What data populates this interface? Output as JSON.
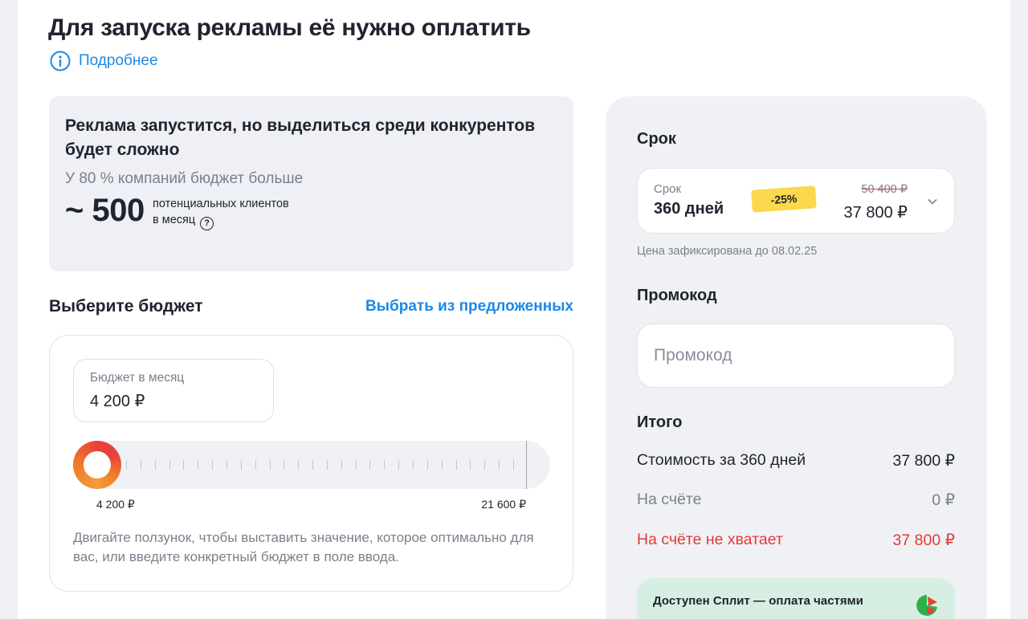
{
  "header": {
    "title": "Для запуска рекламы её нужно оплатить",
    "more_link": "Подробнее"
  },
  "info_card": {
    "headline": "Реклама запустится, но выделиться среди конкурентов будет сложно",
    "subline": "У 80 % компаний бюджет больше",
    "clients_value": "~ 500",
    "clients_note_line1": "потенциальных клиентов",
    "clients_note_line2": "в месяц"
  },
  "budget": {
    "title": "Выберите бюджет",
    "suggest_link": "Выбрать из предложенных",
    "input_label": "Бюджет в месяц",
    "input_value": "4 200 ₽",
    "slider_min_label": "4 200 ₽",
    "slider_max_label": "21 600 ₽",
    "slider_level": 0,
    "hint": "Двигайте ползунок, чтобы выставить значение, которое оптимально для вас, или введите конкретный бюджет в поле ввода."
  },
  "order": {
    "term_title": "Срок",
    "term_label": "Срок",
    "term_value": "360 дней",
    "discount_badge": "-25%",
    "old_price": "50 400 ₽",
    "new_price": "37 800 ₽",
    "price_fixed_note": "Цена зафиксирована до 08.02.25",
    "promo_title": "Промокод",
    "promo_placeholder": "Промокод",
    "promo_value": "",
    "total_title": "Итого",
    "rows": [
      {
        "label": "Стоимость за 360 дней",
        "value": "37 800 ₽"
      },
      {
        "label": "На счёте",
        "value": "0 ₽"
      },
      {
        "label": "На счёте не хватает",
        "value": "37 800 ₽"
      }
    ],
    "split_label": "Доступен Сплит — оплата частями"
  },
  "colors": {
    "accent": "#1e88e5",
    "danger": "#e53935",
    "muted": "#7b7f8c",
    "badge": "#fbd84d",
    "split_bg": "#d7efe3"
  },
  "icons": [
    "info-icon",
    "help-icon",
    "chevron-down-icon",
    "split-logo-icon"
  ]
}
